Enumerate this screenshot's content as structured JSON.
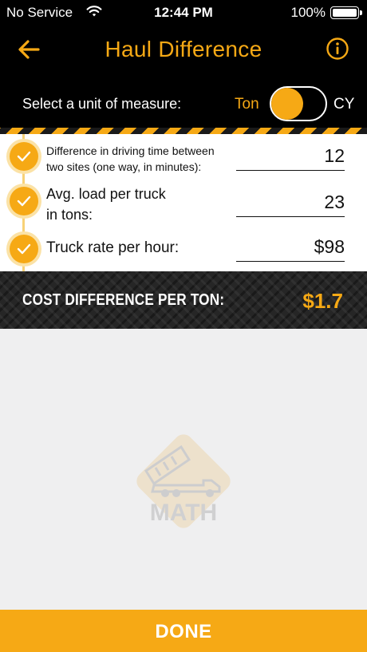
{
  "status": {
    "carrier": "No Service",
    "time": "12:44 PM",
    "battery": "100%"
  },
  "nav": {
    "title": "Haul Difference",
    "back_icon": "arrow-left-icon",
    "info_icon": "info-icon"
  },
  "unit": {
    "label": "Select a unit of measure:",
    "option_left": "Ton",
    "option_right": "CY",
    "selected": "Ton"
  },
  "fields": [
    {
      "label_line1": "Difference in driving time between",
      "label_line2": "two sites (one way, in minutes):",
      "value": "12"
    },
    {
      "label_line1": "Avg. load per truck",
      "label_line2": "in tons:",
      "value": "23"
    },
    {
      "label_line1": "Truck rate per hour:",
      "label_line2": "",
      "value": "$98"
    }
  ],
  "result": {
    "label": "COST DIFFERENCE PER TON:",
    "value": "$1.7"
  },
  "logo": {
    "text": "MATH",
    "icon": "dump-truck-icon"
  },
  "done_label": "DONE",
  "colors": {
    "accent": "#f6a915",
    "background": "#efeff0",
    "dark": "#000000"
  }
}
